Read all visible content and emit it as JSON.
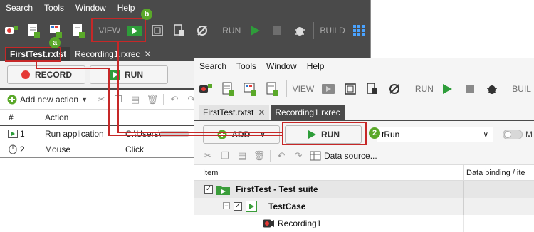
{
  "back_window": {
    "menu": [
      "Search",
      "Tools",
      "Window",
      "Help"
    ],
    "toolbar": {
      "view_label": "VIEW",
      "run_label": "RUN",
      "build_label": "BUILD"
    },
    "tabs": [
      {
        "label": "FirstTest.rxtst"
      },
      {
        "label": "Recording1.rxrec",
        "close": "✕"
      }
    ],
    "record_label": "RECORD",
    "run_button_label": "RUN",
    "add_new_action_label": "Add new action",
    "table": {
      "headers": [
        "#",
        "Action"
      ],
      "rows": [
        {
          "num": "1",
          "action": "Run application",
          "value": "C:\\Users\\"
        },
        {
          "num": "2",
          "action": "Mouse",
          "value": "Click"
        }
      ]
    }
  },
  "front_window": {
    "menu": [
      "Search",
      "Tools",
      "Window",
      "Help"
    ],
    "toolbar": {
      "view_label": "VIEW",
      "run_label": "RUN",
      "build_label": "BUIL"
    },
    "tabs": [
      {
        "label": "FirstTest.rxtst",
        "close": "✕"
      },
      {
        "label": "Recording1.rxrec"
      }
    ],
    "add_label": "ADD",
    "run_button_label": "RUN",
    "test_selector_value": "tRun",
    "toggle_label": "M",
    "data_source_label": "Data source...",
    "tree_headers": {
      "item": "Item",
      "data_binding": "Data binding / ite"
    },
    "tree": [
      {
        "label": "FirstTest - Test suite",
        "level": 0,
        "bold": true
      },
      {
        "label": "TestCase",
        "level": 1,
        "bold": true
      },
      {
        "label": "Recording1",
        "level": 2,
        "bold": false
      }
    ]
  },
  "annotations": {
    "a": "a",
    "b": "b",
    "step2": "2"
  },
  "colors": {
    "highlight": "#c62828",
    "badge": "#5aa829",
    "run_green": "#2e9d3a",
    "record_red": "#e53935"
  }
}
